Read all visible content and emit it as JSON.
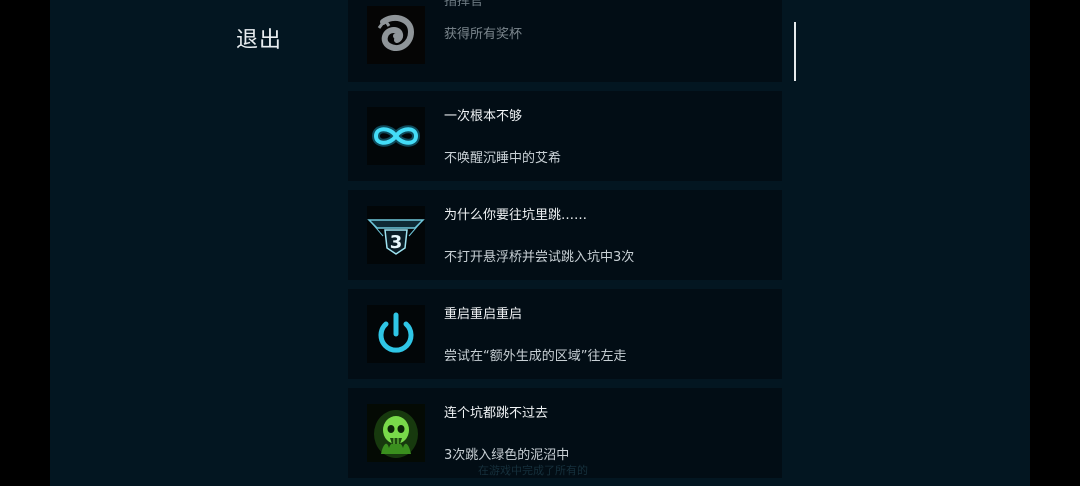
{
  "header": {
    "exit_label": "退出"
  },
  "achievements": [
    {
      "title": "指挥官",
      "description": "获得所有奖杯",
      "icon": "swirl-emblem-icon",
      "state": "partially-scrolled"
    },
    {
      "title": "一次根本不够",
      "description": "不唤醒沉睡中的艾希",
      "icon": "infinity-icon"
    },
    {
      "title": "为什么你要往坑里跳……",
      "description": "不打开悬浮桥并尝试跳入坑中3次",
      "icon": "pit-three-icon",
      "icon_text": "3"
    },
    {
      "title": "重启重启重启",
      "description": "尝试在“额外生成的区域”往左走",
      "icon": "power-icon"
    },
    {
      "title": "连个坑都跳不过去",
      "description": "3次跳入绿色的泥沼中",
      "icon": "green-skull-icon"
    }
  ],
  "footer": {
    "obscured_text": "在游戏中完成了所有的"
  },
  "colors": {
    "background": "#031621",
    "card": "#020d15",
    "accent_cyan": "#33d0ee",
    "slime_green": "#6fd13a"
  }
}
